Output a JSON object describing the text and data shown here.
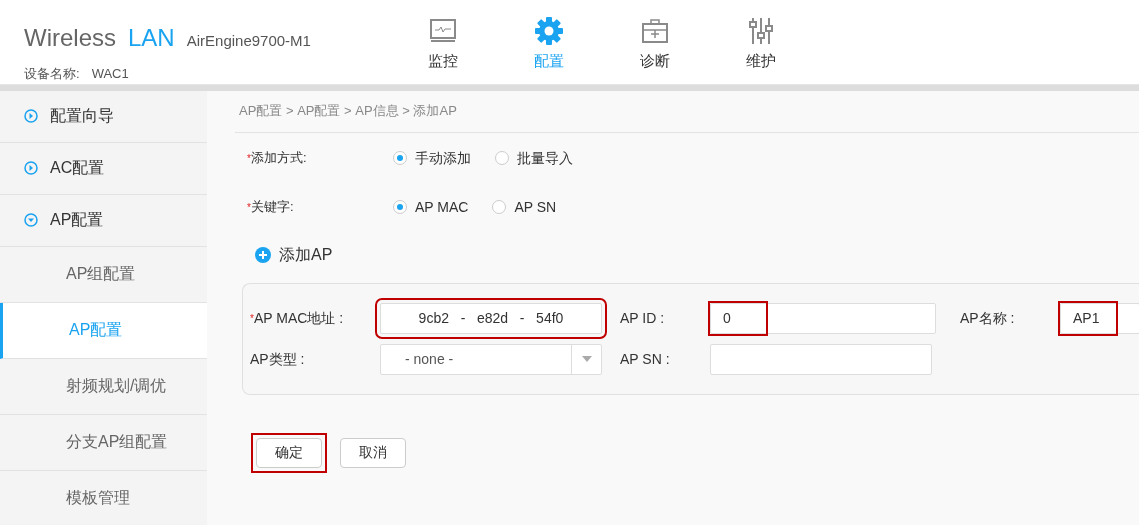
{
  "header": {
    "title": "Wireless",
    "title_accent": "LAN",
    "model": "AirEngine9700-M1",
    "device_label": "设备名称:",
    "device_name": "WAC1",
    "nav": [
      {
        "kind": "monitor",
        "label": "监控",
        "selected": false
      },
      {
        "kind": "gear",
        "label": "配置",
        "selected": true
      },
      {
        "kind": "toolbox",
        "label": "诊断",
        "selected": false
      },
      {
        "kind": "sliders",
        "label": "维护",
        "selected": false
      }
    ]
  },
  "sidebar": {
    "items": [
      {
        "label": "配置向导",
        "expanded": false,
        "selected": false
      },
      {
        "label": "AC配置",
        "expanded": false,
        "selected": false
      },
      {
        "label": "AP配置",
        "expanded": true,
        "selected": false,
        "children": [
          {
            "label": "AP组配置",
            "selected": false
          },
          {
            "label": "AP配置",
            "selected": true
          },
          {
            "label": "射频规划/调优",
            "selected": false
          },
          {
            "label": "分支AP组配置",
            "selected": false
          },
          {
            "label": "模板管理",
            "selected": false
          }
        ]
      }
    ]
  },
  "breadcrumb": "AP配置 > AP配置 > AP信息 > 添加AP",
  "options": [
    {
      "label": "添加方式:",
      "required_mark": "*",
      "choices": [
        {
          "label": "手动添加",
          "selected": true
        },
        {
          "label": "批量导入",
          "selected": false
        }
      ]
    },
    {
      "label": "关键字:",
      "required_mark": "*",
      "choices": [
        {
          "label": "AP MAC",
          "selected": true
        },
        {
          "label": "AP SN",
          "selected": false
        }
      ]
    }
  ],
  "add_link": "添加AP",
  "fields": [
    {
      "label": "AP MAC地址 :",
      "required_mark": "*",
      "kind": "mac",
      "value": "9cb2   -   e82d   -   54f0",
      "highlighted": true
    },
    {
      "label": "AP ID :",
      "kind": "text",
      "value": "0",
      "highlighted": true
    },
    {
      "label": "AP名称 :",
      "kind": "text",
      "value": "AP1",
      "highlighted": true
    },
    {
      "label": "AP类型 :",
      "kind": "select",
      "value": "- none -",
      "highlighted": false
    },
    {
      "label": "AP SN :",
      "kind": "text",
      "highlighted": false
    }
  ],
  "buttons": [
    {
      "label": "确定",
      "highlighted": true
    },
    {
      "label": "取消",
      "highlighted": false
    }
  ]
}
